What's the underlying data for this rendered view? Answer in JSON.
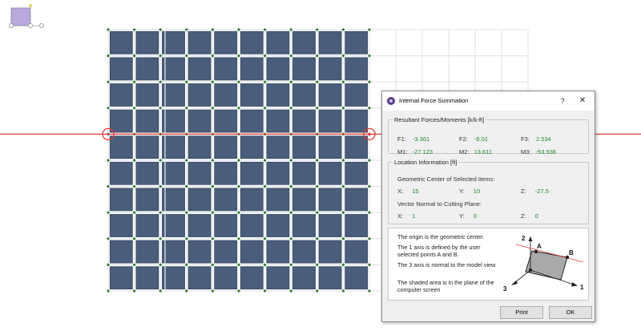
{
  "dialog": {
    "title": "Internal Force Summation",
    "help_glyph": "?",
    "close_glyph": "✕",
    "forces": {
      "legend": "Resultant Forces/Moments [k/k-ft]",
      "F1_label": "F1:",
      "F1": "-3.361",
      "F2_label": "F2:",
      "F2": "-6.01",
      "F3_label": "F3:",
      "F3": "2.534",
      "M1_label": "M1:",
      "M1": "-27.123",
      "M2_label": "M2:",
      "M2": "13.611",
      "M3_label": "M3:",
      "M3": "-53.936"
    },
    "location": {
      "legend": "Location Information [ft]",
      "center_heading": "Geometric Center of Selected Items:",
      "cx_label": "X:",
      "cx": "15",
      "cy_label": "Y:",
      "cy": "10",
      "cz_label": "Z:",
      "cz": "-27.5",
      "normal_heading": "Vector Normal to Cutting Plane:",
      "nx_label": "X:",
      "nx": "1",
      "ny_label": "Y:",
      "ny": "0",
      "nz_label": "Z:",
      "nz": "0"
    },
    "explanation": {
      "line1": "The origin is the geometric center.",
      "line2": "The 1 axis is defined by the user selected points A and B.",
      "line3": "The 3 axis is normal to the model view.",
      "line4": "The shaded area is in the plane of the computer screen"
    },
    "diagram_labels": {
      "axis2": "2",
      "pointA": "A",
      "pointB": "B",
      "axis1": "1",
      "axis3": "3"
    },
    "buttons": {
      "print": "Print",
      "ok": "OK"
    }
  },
  "colors": {
    "panel_fill": "#4a5d7a",
    "panel_edge": "#2f3e55",
    "frame_line": "#e0e0e0",
    "node": "#2e7d32",
    "cut_line": "#e53935",
    "value_text": "#1e8a2c"
  },
  "icons": [
    "app-icon",
    "help-icon",
    "close-icon",
    "axis-widget-icon"
  ]
}
